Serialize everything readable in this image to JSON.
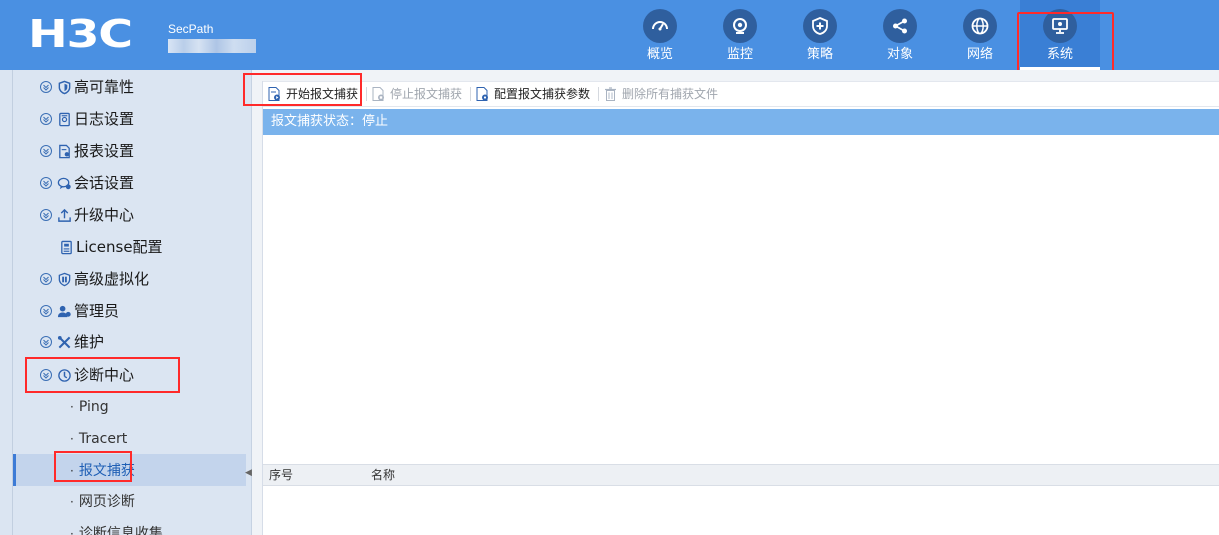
{
  "header": {
    "logo": "H3C",
    "product": "SecPath",
    "nav": [
      {
        "label": "概览",
        "icon": "speedometer-icon"
      },
      {
        "label": "监控",
        "icon": "camera-icon"
      },
      {
        "label": "策略",
        "icon": "shield-plus-icon"
      },
      {
        "label": "对象",
        "icon": "share-icon"
      },
      {
        "label": "网络",
        "icon": "globe-icon"
      },
      {
        "label": "系统",
        "icon": "monitor-gear-icon",
        "active": true
      }
    ]
  },
  "sidebar": {
    "items": [
      {
        "label": "高可靠性",
        "icon": "shield-icon",
        "expandable": true
      },
      {
        "label": "日志设置",
        "icon": "log-icon",
        "expandable": true
      },
      {
        "label": "报表设置",
        "icon": "report-icon",
        "expandable": true
      },
      {
        "label": "会话设置",
        "icon": "chat-icon",
        "expandable": true
      },
      {
        "label": "升级中心",
        "icon": "upload-icon",
        "expandable": true
      },
      {
        "label": "License配置",
        "icon": "license-icon",
        "expandable": false
      },
      {
        "label": "高级虚拟化",
        "icon": "virtualization-icon",
        "expandable": true
      },
      {
        "label": "管理员",
        "icon": "users-icon",
        "expandable": true
      },
      {
        "label": "维护",
        "icon": "tools-icon",
        "expandable": true
      },
      {
        "label": "诊断中心",
        "icon": "diagnosis-icon",
        "expandable": true,
        "expanded": true
      }
    ],
    "sub_items": [
      {
        "label": "Ping"
      },
      {
        "label": "Tracert"
      },
      {
        "label": "报文捕获",
        "selected": true
      },
      {
        "label": "网页诊断"
      },
      {
        "label": "诊断信息收集"
      }
    ]
  },
  "toolbar": {
    "start_capture": "开始报文捕获",
    "stop_capture": "停止报文捕获",
    "config_params": "配置报文捕获参数",
    "delete_files": "删除所有捕获文件"
  },
  "status": {
    "text": "报文捕获状态：停止"
  },
  "table": {
    "columns": [
      "序号",
      "名称"
    ]
  },
  "colors": {
    "topbar": "#4a90e2",
    "status_bar": "#7ab3ec",
    "highlight": "#ff2a2a"
  }
}
